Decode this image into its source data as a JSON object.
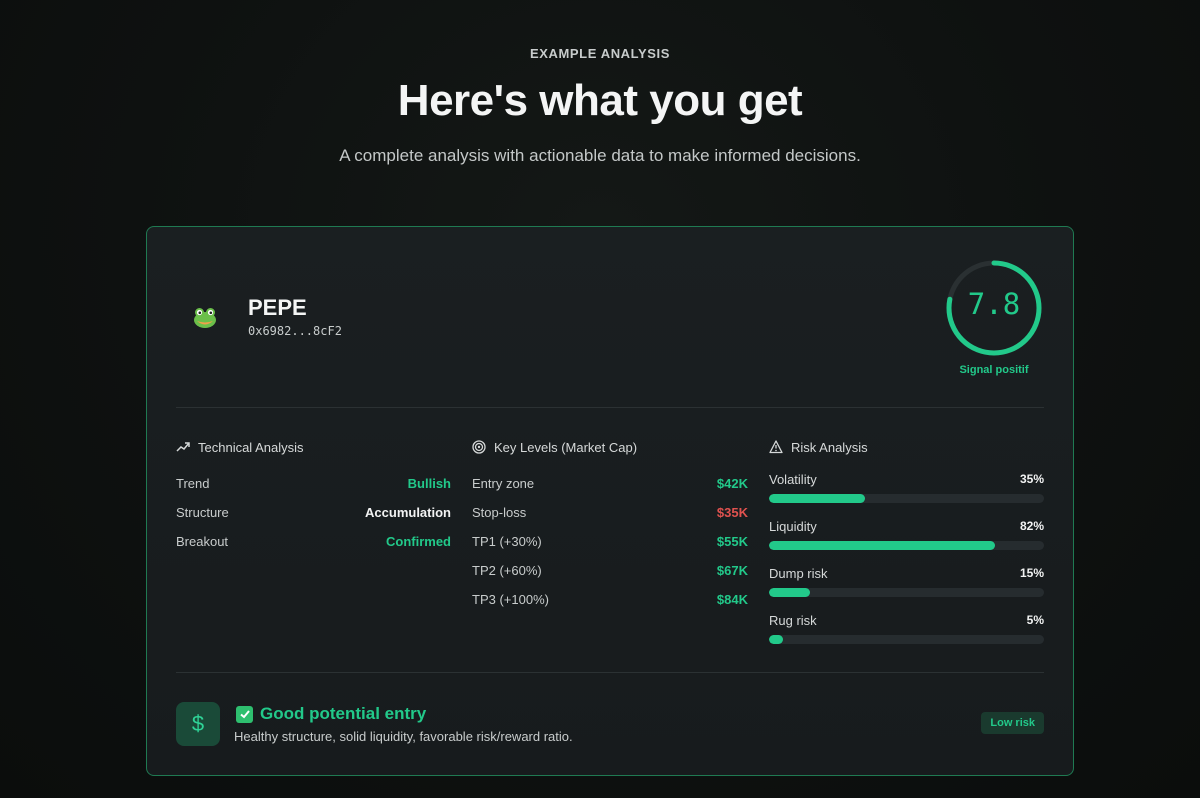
{
  "header": {
    "eyebrow": "EXAMPLE ANALYSIS",
    "title": "Here's what you get",
    "subtitle": "A complete analysis with actionable data to make informed decisions."
  },
  "token": {
    "name": "PEPE",
    "address": "0x6982...8cF2",
    "logo_icon": "frog-icon"
  },
  "score": {
    "value": "7.8",
    "max": 10,
    "label": "Signal positif",
    "color": "#22c98a"
  },
  "technical": {
    "title": "Technical Analysis",
    "icon": "trending-up-icon",
    "rows": [
      {
        "label": "Trend",
        "value": "Bullish",
        "tone": "green"
      },
      {
        "label": "Structure",
        "value": "Accumulation",
        "tone": "white"
      },
      {
        "label": "Breakout",
        "value": "Confirmed",
        "tone": "green"
      }
    ]
  },
  "levels": {
    "title": "Key Levels (Market Cap)",
    "icon": "target-icon",
    "rows": [
      {
        "label": "Entry zone",
        "value": "$42K",
        "tone": "green"
      },
      {
        "label": "Stop-loss",
        "value": "$35K",
        "tone": "red"
      },
      {
        "label": "TP1 (+30%)",
        "value": "$55K",
        "tone": "green"
      },
      {
        "label": "TP2 (+60%)",
        "value": "$67K",
        "tone": "green"
      },
      {
        "label": "TP3 (+100%)",
        "value": "$84K",
        "tone": "green"
      }
    ]
  },
  "risk": {
    "title": "Risk Analysis",
    "icon": "warning-triangle-icon",
    "items": [
      {
        "label": "Volatility",
        "value": "35%",
        "percent": 35
      },
      {
        "label": "Liquidity",
        "value": "82%",
        "percent": 82
      },
      {
        "label": "Dump risk",
        "value": "15%",
        "percent": 15
      },
      {
        "label": "Rug risk",
        "value": "5%",
        "percent": 5
      }
    ]
  },
  "verdict": {
    "icon": "dollar-icon",
    "title": "Good potential entry",
    "description": "Healthy structure, solid liquidity, favorable risk/reward ratio.",
    "badge": "Low risk"
  },
  "colors": {
    "accent": "#22c98a",
    "danger": "#e0524f",
    "card_border": "#1f7a52"
  }
}
